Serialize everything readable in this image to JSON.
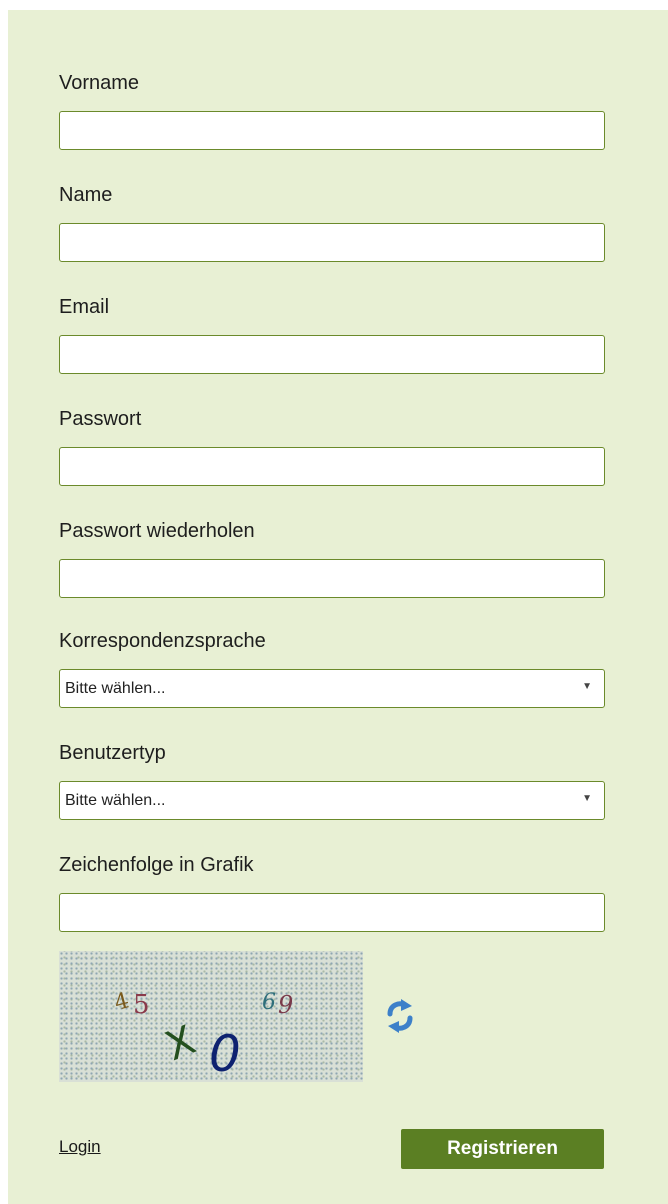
{
  "form": {
    "vorname": {
      "label": "Vorname",
      "value": "",
      "placeholder": ""
    },
    "name": {
      "label": "Name",
      "value": "",
      "placeholder": ""
    },
    "email": {
      "label": "Email",
      "value": "",
      "placeholder": ""
    },
    "passwort": {
      "label": "Passwort",
      "value": "",
      "placeholder": ""
    },
    "passwort_wiederholen": {
      "label": "Passwort wiederholen",
      "value": "",
      "placeholder": ""
    },
    "korrespondenzsprache": {
      "label": "Korrespondenzsprache",
      "selected": "Bitte wählen..."
    },
    "benutzertyp": {
      "label": "Benutzertyp",
      "selected": "Bitte wählen..."
    },
    "zeichenfolge": {
      "label": "Zeichenfolge in Grafik",
      "value": "",
      "placeholder": ""
    }
  },
  "captcha": {
    "characters": [
      "4",
      "5",
      "6",
      "9",
      "X",
      "0"
    ]
  },
  "footer": {
    "login_label": "Login",
    "submit_label": "Registrieren"
  },
  "colors": {
    "panel_background": "#e8f0d4",
    "field_border": "#6b8a2b",
    "button_background": "#5b7f23",
    "refresh_icon": "#3d80c9"
  },
  "icons": {
    "select_arrow": "triangle-down-icon",
    "refresh": "refresh-icon"
  }
}
